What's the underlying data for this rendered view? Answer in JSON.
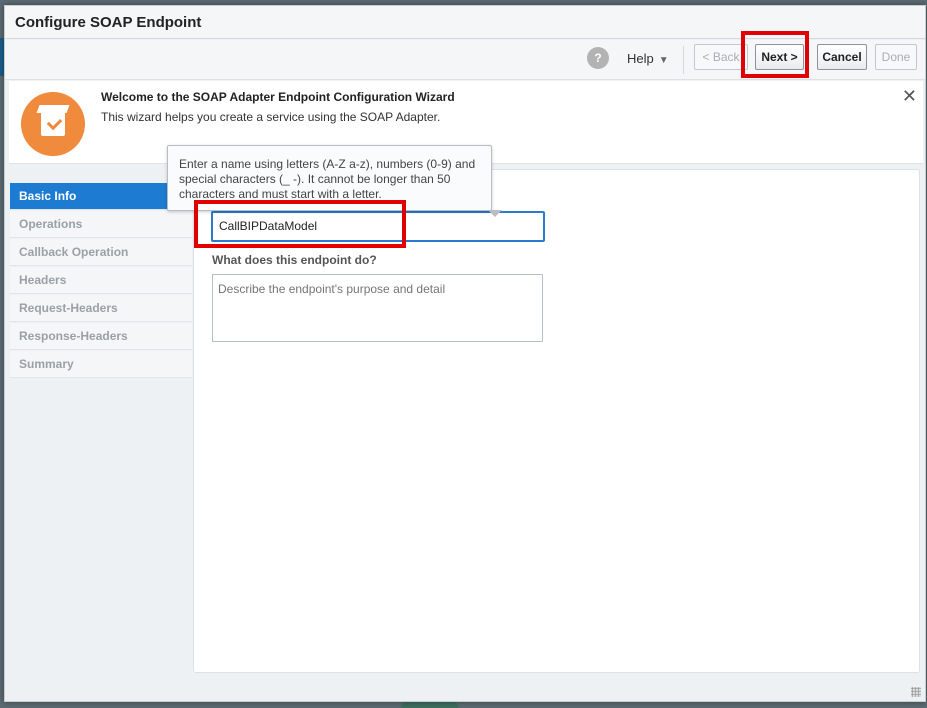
{
  "dialog": {
    "title": "Configure SOAP Endpoint"
  },
  "toolbar": {
    "help_label": "Help",
    "help_caret": "▼",
    "back_label": "< Back",
    "next_label": "Next >",
    "cancel_label": "Cancel",
    "done_label": "Done"
  },
  "welcome": {
    "title": "Welcome to the SOAP Adapter Endpoint Configuration Wizard",
    "subtitle": "This wizard helps you create a service using the SOAP Adapter.",
    "close_glyph": "✕"
  },
  "sidebar": {
    "items": [
      {
        "label": "Basic Info",
        "active": true
      },
      {
        "label": "Operations"
      },
      {
        "label": "Callback Operation"
      },
      {
        "label": "Headers"
      },
      {
        "label": "Request-Headers"
      },
      {
        "label": "Response-Headers"
      },
      {
        "label": "Summary"
      }
    ]
  },
  "form": {
    "name_value": "CallBIPDataModel",
    "description_label": "What does this endpoint do?",
    "description_placeholder": "Describe the endpoint's purpose and detail"
  },
  "tooltip": {
    "text": "Enter a name using letters (A-Z a-z), numbers (0-9) and special characters (_ -). It cannot be longer than 50 characters and must start with a letter."
  },
  "colors": {
    "accent": "#1d7bd1",
    "highlight": "#e00000",
    "wizard_icon": "#f08a3c"
  },
  "icons": {
    "help": "help-icon",
    "wizard": "wizard-icon",
    "close": "close-icon"
  }
}
